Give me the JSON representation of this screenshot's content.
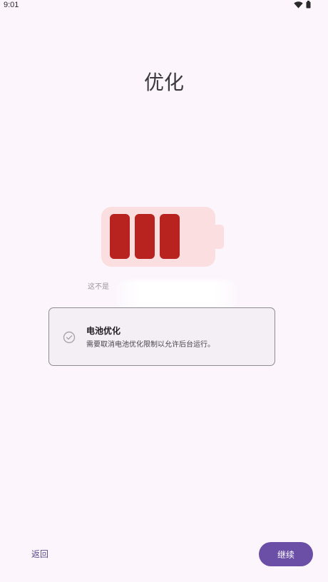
{
  "status_bar": {
    "time": "9:01",
    "icons": [
      "wifi-icon",
      "battery-status-icon"
    ]
  },
  "page": {
    "title": "优化"
  },
  "illustration": {
    "icon": "battery-full-icon",
    "colors": {
      "shell": "#fbdfe0",
      "cells": "#b8221f"
    },
    "ghost_text": "这不是"
  },
  "permission_card": {
    "icon": "check-circle-icon",
    "title": "电池优化",
    "description": "需要取消电池优化限制以允许后台运行。"
  },
  "footer": {
    "back_label": "返回",
    "continue_label": "继续"
  },
  "colors": {
    "background": "#fcf6fc",
    "accent": "#6b4fa6"
  }
}
